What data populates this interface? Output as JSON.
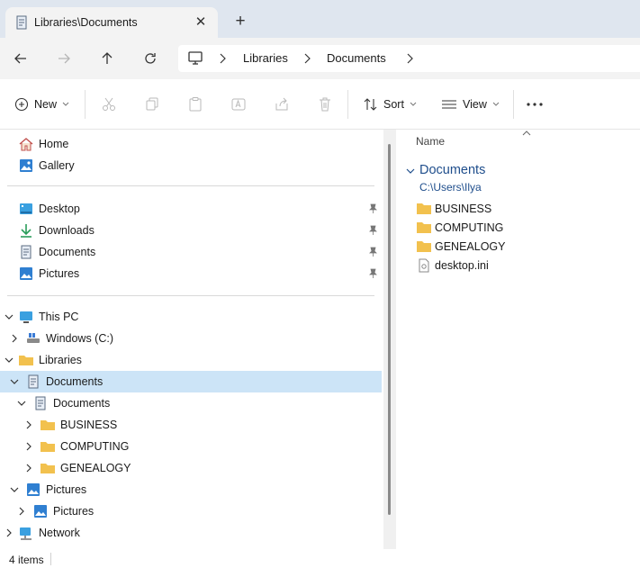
{
  "colors": {
    "accent": "#1f4e8c",
    "selection": "#cce4f7",
    "folder": "#f2c14e"
  },
  "tab": {
    "title": "Libraries\\Documents",
    "close_glyph": "✕",
    "new_glyph": "+"
  },
  "address": {
    "segments": [
      "Libraries",
      "Documents"
    ]
  },
  "commands": {
    "new_label": "New",
    "sort_label": "Sort",
    "view_label": "View",
    "more_glyph": "•••"
  },
  "nav": {
    "home": "Home",
    "gallery": "Gallery",
    "quick": [
      {
        "label": "Desktop",
        "icon": "desktop-icon"
      },
      {
        "label": "Downloads",
        "icon": "download-icon"
      },
      {
        "label": "Documents",
        "icon": "documents-icon"
      },
      {
        "label": "Pictures",
        "icon": "pictures-icon"
      }
    ],
    "tree": {
      "this_pc": "This PC",
      "windows_c": "Windows (C:)",
      "libraries": "Libraries",
      "documents_lib": "Documents",
      "documents_folder": "Documents",
      "business": "BUSINESS",
      "computing": "COMPUTING",
      "genealogy": "GENEALOGY",
      "pictures_lib": "Pictures",
      "pictures_folder": "Pictures",
      "network": "Network"
    }
  },
  "content": {
    "column_name": "Name",
    "group_title": "Documents",
    "group_path": "C:\\Users\\Ilya",
    "items": [
      {
        "name": "BUSINESS",
        "type": "folder"
      },
      {
        "name": "COMPUTING",
        "type": "folder"
      },
      {
        "name": "GENEALOGY",
        "type": "folder"
      },
      {
        "name": "desktop.ini",
        "type": "file"
      }
    ]
  },
  "status": {
    "count": "4 items"
  }
}
